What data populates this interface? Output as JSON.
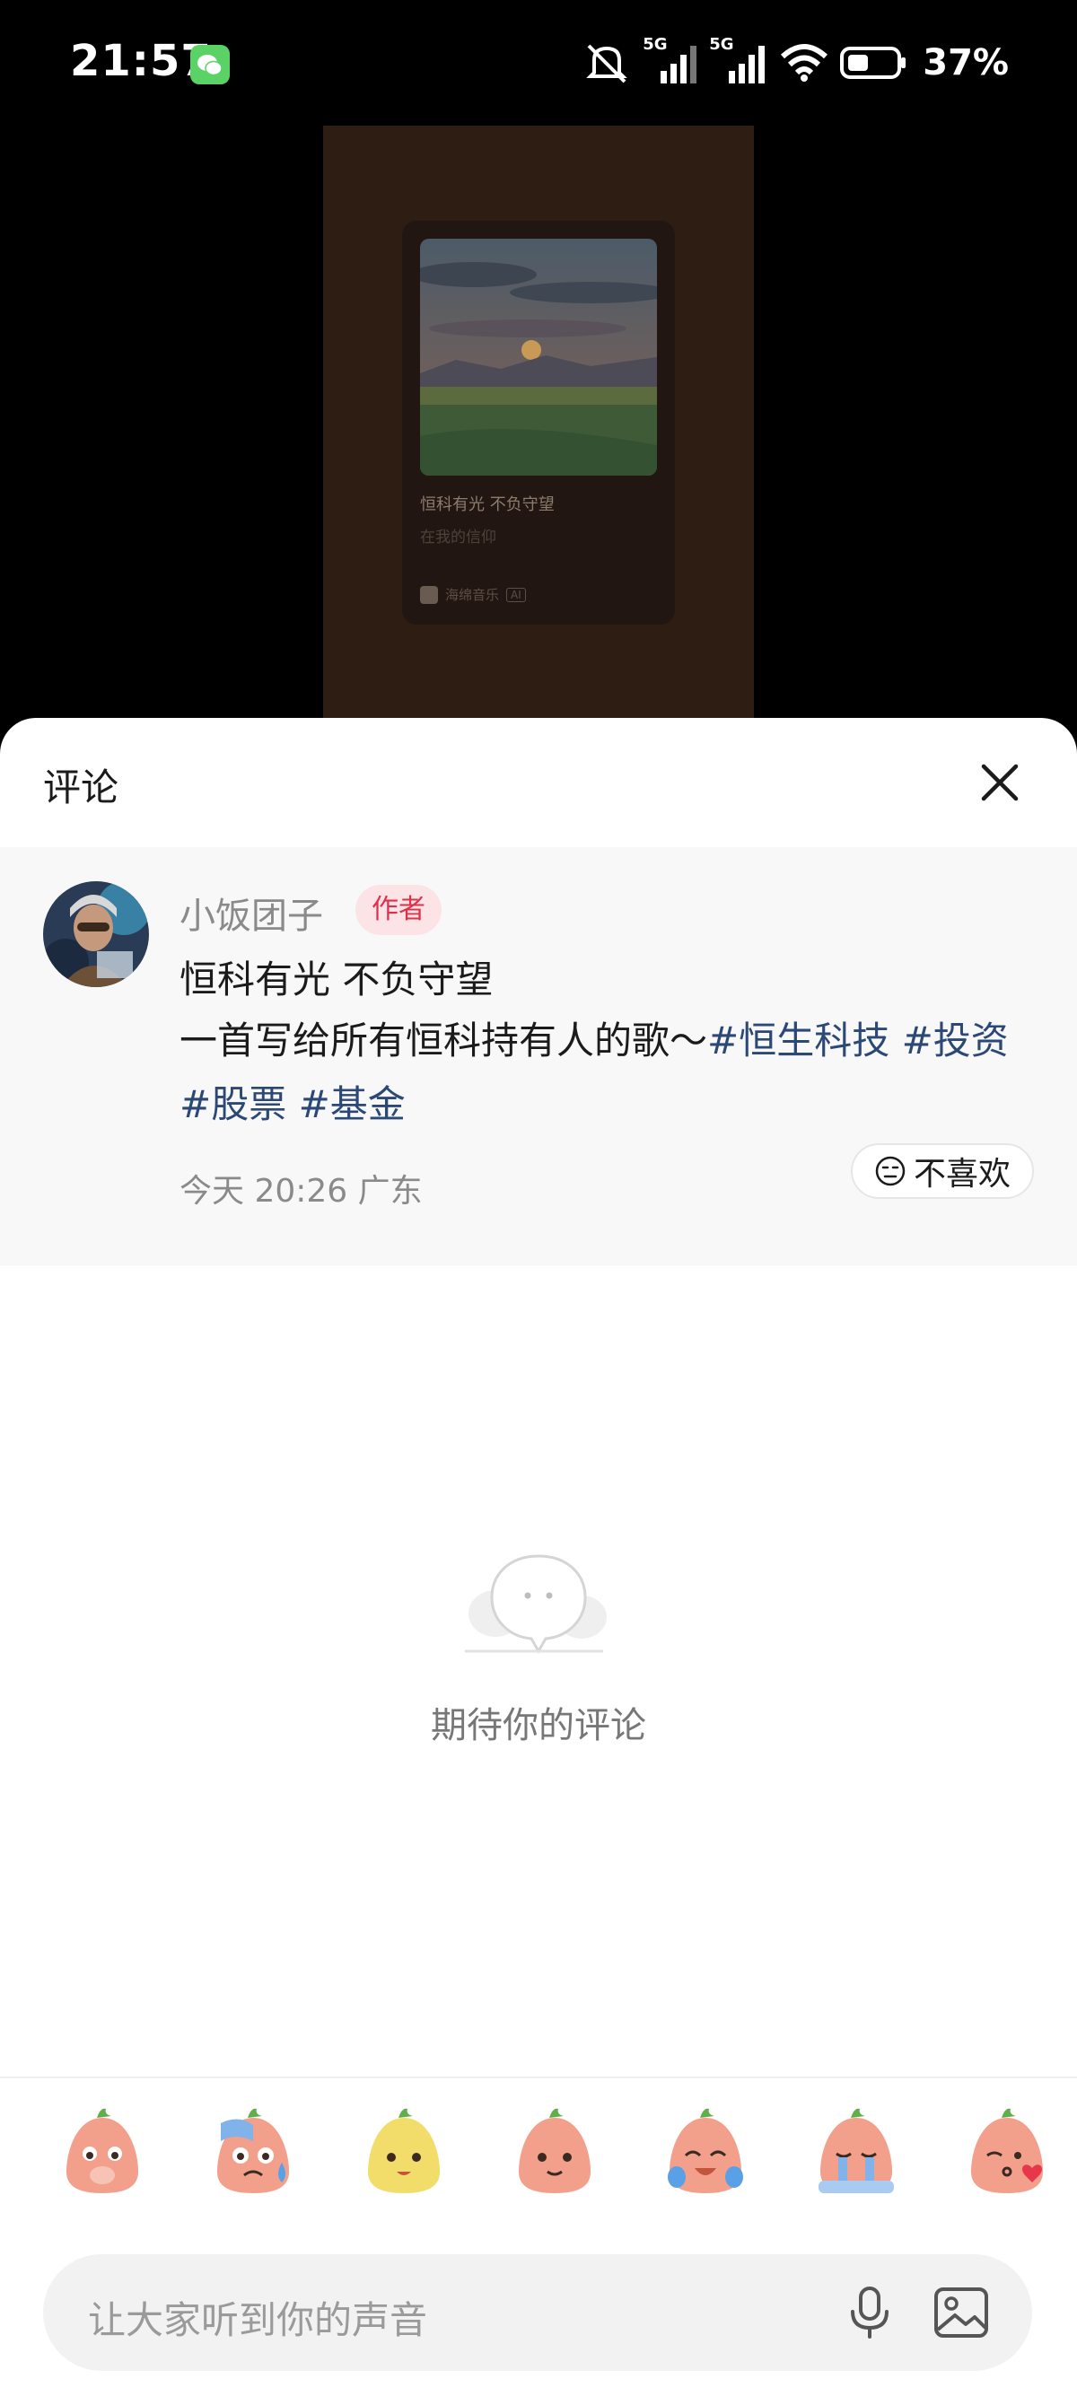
{
  "status_bar": {
    "time": "21:57",
    "signal_1": "5G",
    "signal_2": "5G",
    "battery": "37%",
    "icons": [
      "wechat-icon",
      "bell-mute-icon",
      "signal-icon",
      "wifi-icon",
      "battery-icon"
    ]
  },
  "video": {
    "song_title": "恒科有光 不负守望",
    "song_subtitle": "在我的信仰",
    "app_name": "海绵音乐",
    "app_tag": "AI"
  },
  "comments_sheet": {
    "title": "评论",
    "close_icon": "close-icon"
  },
  "post": {
    "author": "小饭团子",
    "author_tag": "作者",
    "title": "恒科有光 不负守望",
    "body_prefix": "一首写给所有恒科持有人的歌～",
    "hashtags": [
      "#恒生科技",
      "#投资",
      "#股票",
      "#基金"
    ],
    "time": "今天 20:26",
    "location": "广东",
    "dislike_label": "不喜欢"
  },
  "empty_state": {
    "text": "期待你的评论"
  },
  "emoji_bar": {
    "items": [
      "cover-mouth",
      "sweat",
      "yellow-smile",
      "smile",
      "laugh-cry",
      "cry",
      "kiss"
    ]
  },
  "input": {
    "placeholder": "让大家听到你的声音"
  },
  "colors": {
    "accent": "#2c4876",
    "author_tag_bg": "#fbe3e6",
    "author_tag_text": "#e1304a",
    "background": "#ffffff"
  }
}
